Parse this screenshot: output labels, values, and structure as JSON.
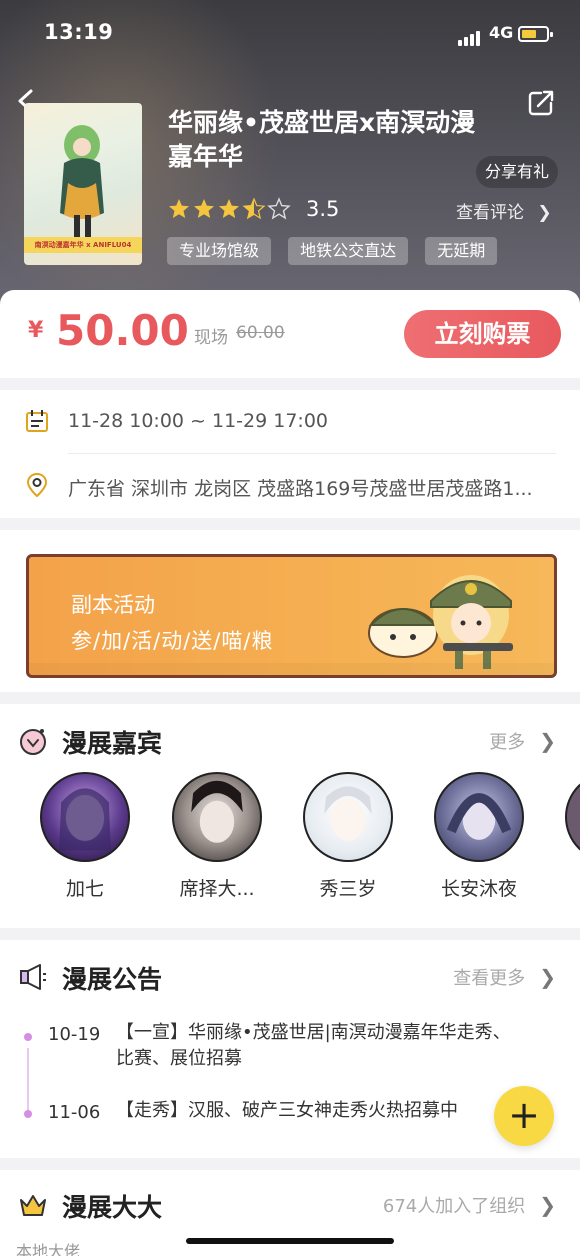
{
  "status_bar": {
    "time": "13:19",
    "network": "4G"
  },
  "event": {
    "title": "华丽缘•茂盛世居x南溟动漫嘉年华",
    "share_gift": "分享有礼",
    "rating": 3.5,
    "rating_text": "3.5",
    "reviews_link": "查看评论",
    "tags": [
      "专业场馆级",
      "地铁公交直达",
      "无延期"
    ],
    "poster_band": "南溟动漫嘉年华 x ANIFLU04"
  },
  "price": {
    "currency": "¥",
    "value": "50.00",
    "onsite_label": "现场",
    "onsite_value": "60.00",
    "buy_label": "立刻购票"
  },
  "info": {
    "time_range": "11-28 10:00 ~ 11-29 17:00",
    "address": "广东省 深圳市 龙岗区 茂盛路169号茂盛世居茂盛路1..."
  },
  "activity": {
    "title": "副本活动",
    "subtitle": "参/加/活/动/送/喵/粮"
  },
  "guests_section": {
    "title": "漫展嘉宾",
    "more": "更多",
    "guests": [
      {
        "name": "加七"
      },
      {
        "name": "席择大..."
      },
      {
        "name": "秀三岁"
      },
      {
        "name": "长安沐夜"
      }
    ]
  },
  "notice_section": {
    "title": "漫展公告",
    "more": "查看更多",
    "items": [
      {
        "date": "10-19",
        "text": "【一宣】华丽缘•茂盛世居|南溟动漫嘉年华走秀、比赛、展位招募"
      },
      {
        "date": "11-06",
        "text": "【走秀】汉服、破产三女神走秀火热招募中"
      }
    ]
  },
  "organizer_section": {
    "title": "漫展大大",
    "more": "674人加入了组织",
    "local_label": "本地大佬"
  },
  "fab": {
    "label": "+"
  },
  "colors": {
    "accent": "#e8595e",
    "fab": "#f8d944",
    "activity": "#f4a24a"
  }
}
